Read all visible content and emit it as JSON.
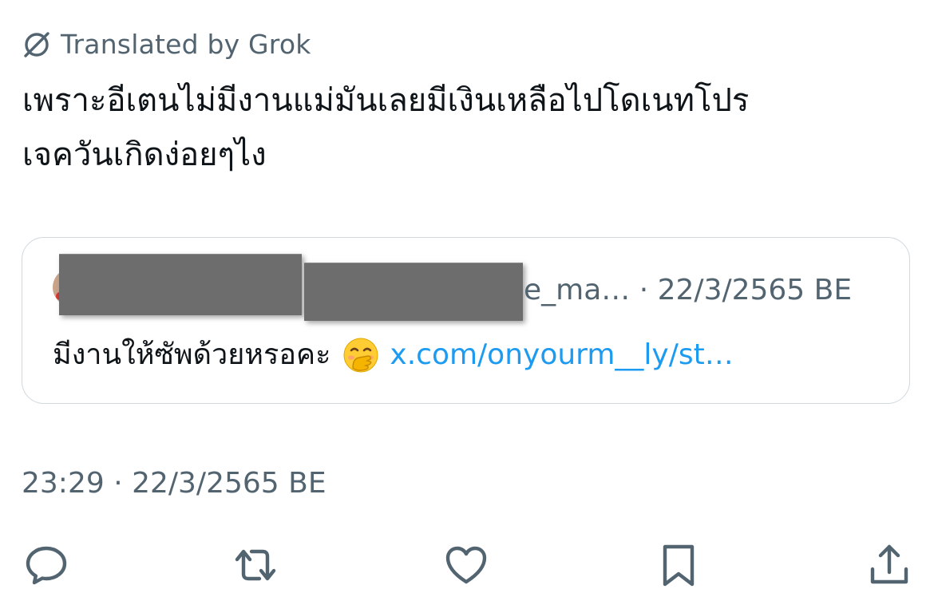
{
  "translation": {
    "label": "Translated by Grok",
    "icon": "translate-slash-icon"
  },
  "tweet": {
    "line1": "เพราะอีเตนไม่มีงานแม่มันเลยมีเงินเหลือไปโดเนทโปร",
    "line2": "เจควันเกิดง่อยๆไง"
  },
  "quote": {
    "handle_fragment": "e_ma…",
    "separator": " · ",
    "date": "22/3/2565 BE",
    "text": "มีงานให้ซัพด้วยหรอคะ",
    "emoji": "face-with-hand-over-mouth",
    "link": "x.com/onyourm__ly/st…"
  },
  "meta": {
    "time": "23:29",
    "separator": " · ",
    "date": "22/3/2565 BE"
  },
  "actions": {
    "reply": "reply-icon",
    "repost": "repost-icon",
    "like": "heart-icon",
    "bookmark": "bookmark-icon",
    "share": "share-icon"
  },
  "colors": {
    "text": "#0f1419",
    "secondary": "#536471",
    "link": "#1d9bf0",
    "border": "#cfd9de"
  }
}
